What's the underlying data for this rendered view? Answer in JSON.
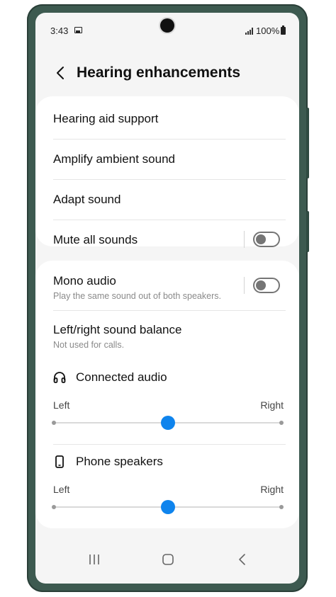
{
  "status_bar": {
    "time": "3:43",
    "battery": "100%"
  },
  "header": {
    "title": "Hearing enhancements"
  },
  "group1": {
    "items": [
      {
        "label": "Hearing aid support"
      },
      {
        "label": "Amplify ambient sound"
      },
      {
        "label": "Adapt sound"
      },
      {
        "label": "Mute all sounds",
        "toggle_on": false
      }
    ]
  },
  "group2": {
    "mono": {
      "label": "Mono audio",
      "sub": "Play the same sound out of both speakers.",
      "toggle_on": false
    },
    "balance": {
      "label": "Left/right sound balance",
      "sub": "Not used for calls."
    },
    "connected_audio": {
      "label": "Connected audio",
      "left": "Left",
      "right": "Right",
      "value": 0.5
    },
    "phone_speakers": {
      "label": "Phone speakers",
      "left": "Left",
      "right": "Right",
      "value": 0.5
    }
  },
  "colors": {
    "accent": "#0f84ed",
    "toggle_off": "#757575",
    "frame": "#3d5a50"
  },
  "icons": {
    "back": "chevron-left-icon",
    "headphones": "headphones-icon",
    "phone": "phone-icon"
  }
}
